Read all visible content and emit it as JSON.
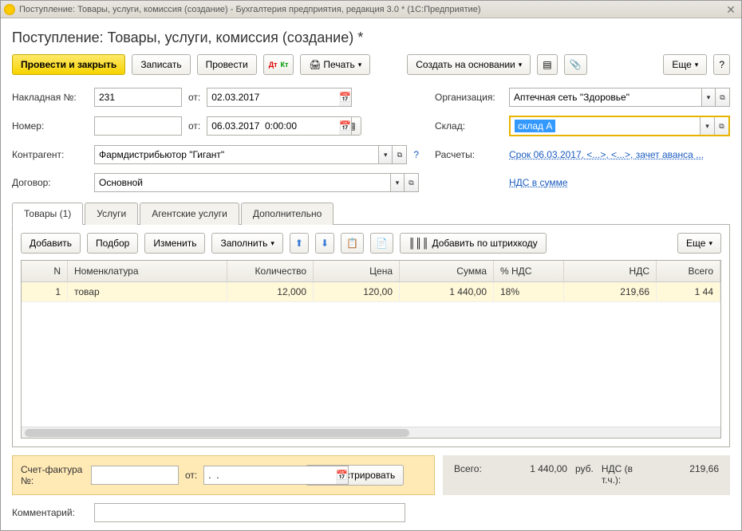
{
  "window": {
    "title": "Поступление: Товары, услуги, комиссия (создание) - Бухгалтерия предприятия, редакция 3.0 *  (1С:Предприятие)"
  },
  "page_title": "Поступление: Товары, услуги, комиссия (создание) *",
  "toolbar": {
    "post_close": "Провести и закрыть",
    "save": "Записать",
    "post": "Провести",
    "print": "Печать",
    "create_based": "Создать на основании",
    "more": "Еще",
    "help": "?"
  },
  "fields": {
    "invoice_no_lbl": "Накладная  №:",
    "invoice_no_val": "231",
    "from_lbl": "от:",
    "invoice_date": "02.03.2017",
    "number_lbl": "Номер:",
    "number_val": "",
    "doc_date": "06.03.2017  0:00:00",
    "org_lbl": "Организация:",
    "org_val": "Аптечная сеть \"Здоровье\"",
    "warehouse_lbl": "Склад:",
    "warehouse_val": "склад А",
    "counterparty_lbl": "Контрагент:",
    "counterparty_val": "Фармдистрибьютор \"Гигант\"",
    "settlements_lbl": "Расчеты:",
    "settlements_link": "Срок 06.03.2017, <...>, <...>, зачет аванса ...",
    "contract_lbl": "Договор:",
    "contract_val": "Основной",
    "vat_link": "НДС в сумме"
  },
  "tabs": {
    "goods": "Товары (1)",
    "services": "Услуги",
    "agency": "Агентские услуги",
    "extra": "Дополнительно"
  },
  "subtoolbar": {
    "add": "Добавить",
    "pick": "Подбор",
    "edit": "Изменить",
    "fill": "Заполнить",
    "barcode": "Добавить по штрихкоду",
    "more": "Еще"
  },
  "grid": {
    "headers": {
      "n": "N",
      "nom": "Номенклатура",
      "qty": "Количество",
      "price": "Цена",
      "sum": "Сумма",
      "vatp": "% НДС",
      "vat": "НДС",
      "total": "Всего"
    },
    "rows": [
      {
        "n": "1",
        "nom": "товар",
        "qty": "12,000",
        "price": "120,00",
        "sum": "1 440,00",
        "vatp": "18%",
        "vat": "219,66",
        "total": "1 44"
      }
    ]
  },
  "invoice": {
    "label": "Счет-фактура №:",
    "no": "",
    "from": "от:",
    "date": ".  .",
    "register": "Зарегистрировать"
  },
  "totals": {
    "total_lbl": "Всего:",
    "total_val": "1 440,00",
    "currency": "руб.",
    "vat_lbl": "НДС (в т.ч.):",
    "vat_val": "219,66"
  },
  "comment_lbl": "Комментарий:",
  "comment_val": ""
}
